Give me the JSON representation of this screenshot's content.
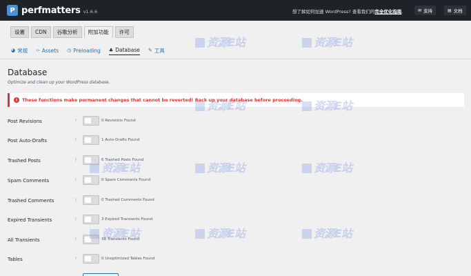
{
  "header": {
    "logo_mark": "P",
    "brand": "perfmatters",
    "version": "v1.6.6",
    "promo_prefix": "想了解如何加速 WordPress? 查看我们的",
    "promo_link": "完全优化指南",
    "promo_suffix": ".",
    "support_label": "支持",
    "docs_label": "文档"
  },
  "tabs": [
    {
      "label": "设置"
    },
    {
      "label": "CDN"
    },
    {
      "label": "谷歌分析"
    },
    {
      "label": "附加功能"
    },
    {
      "label": "许可"
    }
  ],
  "subtabs": [
    {
      "label": "常规"
    },
    {
      "label": "Assets"
    },
    {
      "label": "Preloading"
    },
    {
      "label": "Database"
    },
    {
      "label": "工具"
    }
  ],
  "page": {
    "title": "Database",
    "description": "Optimize and clean up your WordPress database.",
    "warning": "These functions make permanent changes that cannot be reverted! Back up your database before proceeding."
  },
  "rows": [
    {
      "label": "Post Revisions",
      "count": "0 Revisions Found"
    },
    {
      "label": "Post Auto-Drafts",
      "count": "1 Auto-Drafts Found"
    },
    {
      "label": "Trashed Posts",
      "count": "6 Trashed Posts Found"
    },
    {
      "label": "Spam Comments",
      "count": "0 Spam Comments Found"
    },
    {
      "label": "Trashed Comments",
      "count": "0 Trashed Comments Found"
    },
    {
      "label": "Expired Transients",
      "count": "3 Expired Transients Found"
    },
    {
      "label": "All Transients",
      "count": "38 Transients Found"
    },
    {
      "label": "Tables",
      "count": "0 Unoptimized Tables Found"
    }
  ],
  "help_glyph": "?",
  "watermark": "资源E站"
}
